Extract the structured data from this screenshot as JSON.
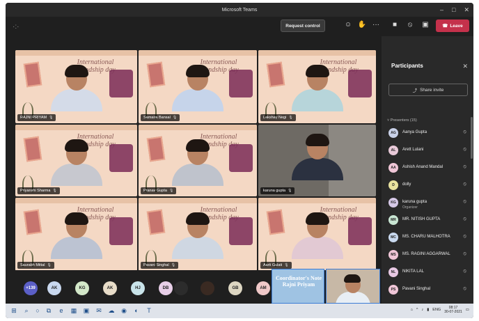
{
  "window": {
    "title": "Microsoft Teams"
  },
  "toolbar": {
    "request_control": "Request control",
    "leave": "Leave"
  },
  "tiles": [
    {
      "name": "RAJNI PRIYAM",
      "kind": "poster"
    },
    {
      "name": "Samaira Bansal",
      "kind": "poster"
    },
    {
      "name": "Lakshay Negi",
      "kind": "poster"
    },
    {
      "name": "Priyanshi Sharma",
      "kind": "poster"
    },
    {
      "name": "Pranav Gupta",
      "kind": "poster"
    },
    {
      "name": "karuna gupta",
      "kind": "room"
    },
    {
      "name": "Saurabh Mittal",
      "kind": "poster"
    },
    {
      "name": "Pavani Singhal",
      "kind": "poster"
    },
    {
      "name": "Aarti Gulati",
      "kind": "poster"
    }
  ],
  "poster": {
    "title_line1": "International",
    "title_line2": "friendship day"
  },
  "avatar_bar": {
    "more": "+139",
    "initials": [
      "AK",
      "KG",
      "AK",
      "HJ",
      "DB",
      "GB",
      "AM"
    ],
    "coordinator": "Coordinator's Note Rajni Priyam"
  },
  "panel": {
    "title": "Participants",
    "share_invite": "Share invite",
    "presenters_label": "Presenters (15)",
    "participants": [
      {
        "name": "Aanya Gupta",
        "role": "",
        "color": "#c9d1e8"
      },
      {
        "name": "Arett Lulani",
        "role": "",
        "color": "#e8c9d8"
      },
      {
        "name": "Ashish Anand Mandal",
        "role": "",
        "color": "#f0c6d7"
      },
      {
        "name": "dolly",
        "role": "",
        "color": "#e8e29f"
      },
      {
        "name": "karuna gupta",
        "role": "Organizer",
        "color": "#d5c8e6"
      },
      {
        "name": "MR. NITISH GUPTA",
        "role": "",
        "color": "#c9e6d3"
      },
      {
        "name": "MS. CHARU MALHOTRA",
        "role": "",
        "color": "#c9d9ef"
      },
      {
        "name": "MS. RAGINI AGGARWAL",
        "role": "",
        "color": "#f0c6d7"
      },
      {
        "name": "NIKITA LAL",
        "role": "",
        "color": "#e8c9e4"
      },
      {
        "name": "Pavani Singhal",
        "role": "",
        "color": "#f0c6d7"
      }
    ],
    "initials": [
      "AG",
      "AL",
      "AA",
      "D",
      "KG",
      "MR",
      "MC",
      "MS",
      "NL",
      "PS"
    ]
  },
  "taskbar": {
    "lang": "ENG",
    "time": "08:17",
    "date": "30-07-2021"
  }
}
